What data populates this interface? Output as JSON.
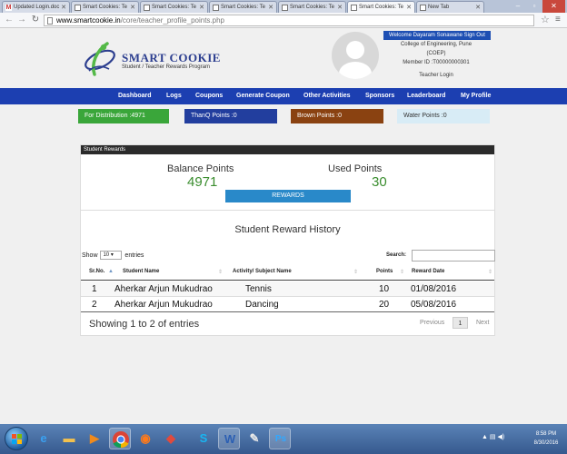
{
  "browser": {
    "tabs": [
      {
        "label": "Updated Login.doc",
        "icon": "gmail-icon"
      },
      {
        "label": "Smart Cookies: Te",
        "icon": "page-icon"
      },
      {
        "label": "Smart Cookies: Te",
        "icon": "page-icon"
      },
      {
        "label": "Smart Cookies: Te",
        "icon": "page-icon"
      },
      {
        "label": "Smart Cookies: Te",
        "icon": "page-icon"
      },
      {
        "label": "Smart Cookies: Te",
        "icon": "page-icon"
      },
      {
        "label": "New Tab",
        "icon": "page-icon"
      }
    ],
    "active_tab": 5,
    "url_host": "www.smartcookie.in",
    "url_path": "/core/teacher_profile_points.php"
  },
  "header": {
    "logo_title": "SMART COOKIE",
    "logo_subtitle": "Student / Teacher Rewards Program",
    "welcome_signout": "Welcome Dayaram Sonawane Sign Out",
    "college_line1": "College of Engineering, Pune",
    "college_line2": "(COEP)",
    "member_id": "Member ID :T00000000301",
    "login_type": "Teacher Login"
  },
  "nav": {
    "items": [
      "Dashboard",
      "Logs",
      "Coupons",
      "Generate Coupon",
      "Other Activities",
      "Sponsors",
      "Leaderboard",
      "My Profile"
    ]
  },
  "points": {
    "distribution": "For Distribution :4971",
    "thanq": "ThanQ Points :0",
    "brown": "Brown Points :0",
    "water": "Water Points :0"
  },
  "rewards": {
    "panel_title": "Student Rewards",
    "balance_label": "Balance Points",
    "balance_value": "4971",
    "used_label": "Used Points",
    "used_value": "30",
    "rewards_button": "REWARDS",
    "history_title": "Student Reward History",
    "show_label": "Show",
    "entries_value": "10",
    "entries_label": "entries",
    "search_label": "Search:",
    "columns": [
      "Sr.No.",
      "Student Name",
      "Activity/ Subject Name",
      "Points",
      "Reward Date"
    ],
    "rows": [
      {
        "sr": "1",
        "name": "Aherkar Arjun Mukudrao",
        "activity": "Tennis",
        "points": "10",
        "date": "01/08/2016"
      },
      {
        "sr": "2",
        "name": "Aherkar Arjun Mukudrao",
        "activity": "Dancing",
        "points": "20",
        "date": "05/08/2016"
      }
    ],
    "showing_text": "Showing  1 to 2 of entries",
    "pagination": {
      "previous": "Previous",
      "page": "1",
      "next": "Next"
    }
  },
  "taskbar": {
    "apps": [
      "ie-icon",
      "file-explorer-icon",
      "media-player-icon",
      "chrome-icon",
      "firefox-icon",
      "paint-icon",
      "skype-icon",
      "word-icon",
      "paint-app-icon",
      "photoshop-icon"
    ],
    "time": "8:58 PM",
    "date": "8/30/2016"
  },
  "colors": {
    "nav_blue": "#1c3fb1",
    "green": "#3aa63a",
    "brown": "#8a4211",
    "water": "#d8ecf6",
    "rewards_button": "#2989c9"
  }
}
